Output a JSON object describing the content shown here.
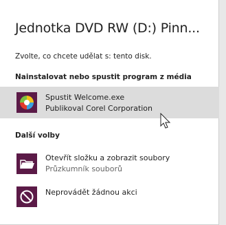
{
  "dialog": {
    "title": "Jednotka DVD RW (D:) Pinn...",
    "subtitle": "Zvolte, co chcete udělat s: tento disk."
  },
  "sections": [
    {
      "header": "Nainstalovat nebo spustit program z média",
      "options": [
        {
          "primary": "Spustit Welcome.exe",
          "secondary": "Publikoval Corel Corporation",
          "icon": "corel-app-icon",
          "selected": true
        }
      ]
    },
    {
      "header": "Další volby",
      "options": [
        {
          "primary": "Otevřít složku a zobrazit soubory",
          "secondary": "Průzkumník souborů",
          "icon": "folder-open-icon",
          "selected": false
        },
        {
          "primary": "Neprovádět žádnou akci",
          "secondary": "",
          "icon": "no-action-icon",
          "selected": false
        }
      ]
    }
  ],
  "colors": {
    "accent": "#5b1a47",
    "selected_bg": "#dcdcdc"
  }
}
